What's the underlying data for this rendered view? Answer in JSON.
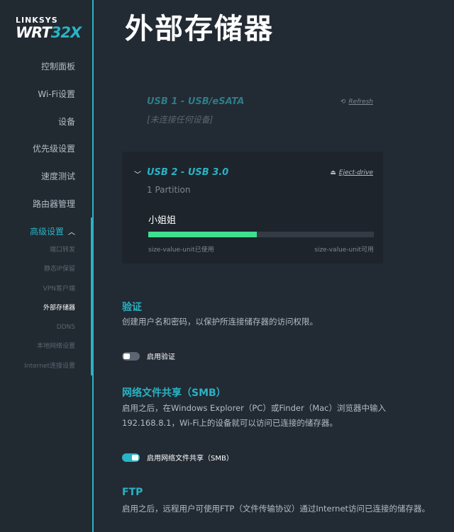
{
  "logo": {
    "brand": "LINKSYS",
    "model_main": "WRT",
    "model_accent": "32X"
  },
  "nav": {
    "items": [
      {
        "label": "控制面板"
      },
      {
        "label": "Wi-Fi设置"
      },
      {
        "label": "设备"
      },
      {
        "label": "优先级设置"
      },
      {
        "label": "速度测试"
      },
      {
        "label": "路由器管理"
      },
      {
        "label": "高级设置"
      }
    ],
    "sub_items": [
      {
        "label": "端口转发"
      },
      {
        "label": "静态IP保留"
      },
      {
        "label": "VPN客户端"
      },
      {
        "label": "外部存储器"
      },
      {
        "label": "DDNS"
      },
      {
        "label": "本地网络设置"
      },
      {
        "label": "Internet连接设置"
      }
    ]
  },
  "page": {
    "title": "外部存储器"
  },
  "usb1": {
    "title": "USB 1 - USB/eSATA",
    "status": "[未连接任何设备]",
    "action": "Refresh",
    "action_icon": "refresh-icon"
  },
  "usb2": {
    "title": "USB 2 - USB 3.0",
    "partitions": "1 Partition",
    "action": "Eject-drive",
    "action_icon": "eject-icon",
    "partition_name": "小姐姐",
    "used_fraction": 0.48,
    "used_label": "size-value-unit已使用",
    "free_label": "size-value-unit可用"
  },
  "auth": {
    "title": "验证",
    "desc": "创建用户名和密码，以保护所连接储存器的访问权限。",
    "toggle_label": "启用验证",
    "enabled": false
  },
  "smb": {
    "title": "网络文件共享（SMB）",
    "desc": "启用之后，在Windows Explorer（PC）或Finder（Mac）浏览器中输入192.168.8.1，Wi-Fi上的设备就可以访问已连接的储存器。",
    "toggle_label": "启用网络文件共享（SMB）",
    "enabled": true
  },
  "ftp": {
    "title": "FTP",
    "desc": "启用之后，远程用户可使用FTP（文件传输协议）通过Internet访问已连接的储存器。"
  },
  "colors": {
    "accent": "#29b3c4",
    "usage_bar": "#3ee08d",
    "background": "#222a33"
  }
}
